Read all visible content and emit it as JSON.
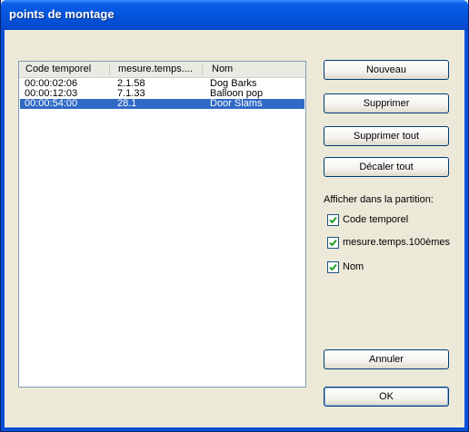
{
  "window": {
    "title": "points de montage"
  },
  "list": {
    "columns": [
      "Code temporel",
      "mesure.temps....",
      "Nom"
    ],
    "rows": [
      {
        "timecode": "00:00:02:06",
        "measure": "2.1.58",
        "name": "Dog Barks",
        "selected": false
      },
      {
        "timecode": "00:00:12:03",
        "measure": "7.1.33",
        "name": "Balloon pop",
        "selected": false
      },
      {
        "timecode": "00:00:54:00",
        "measure": "28.1",
        "name": "Door Slams",
        "selected": true
      }
    ]
  },
  "buttons": {
    "new": "Nouveau",
    "delete": "Supprimer",
    "delete_all": "Supprimer tout",
    "shift_all": "Décaler tout",
    "cancel": "Annuler",
    "ok": "OK"
  },
  "display": {
    "label": "Afficher dans la partition:",
    "options": [
      {
        "label": "Code temporel",
        "checked": true
      },
      {
        "label": "mesure.temps.100èmes",
        "checked": true
      },
      {
        "label": "Nom",
        "checked": true
      }
    ]
  },
  "colors": {
    "title_bar": "#0453DB",
    "selection": "#316AC5",
    "dialog_bg": "#ECE9D8"
  }
}
